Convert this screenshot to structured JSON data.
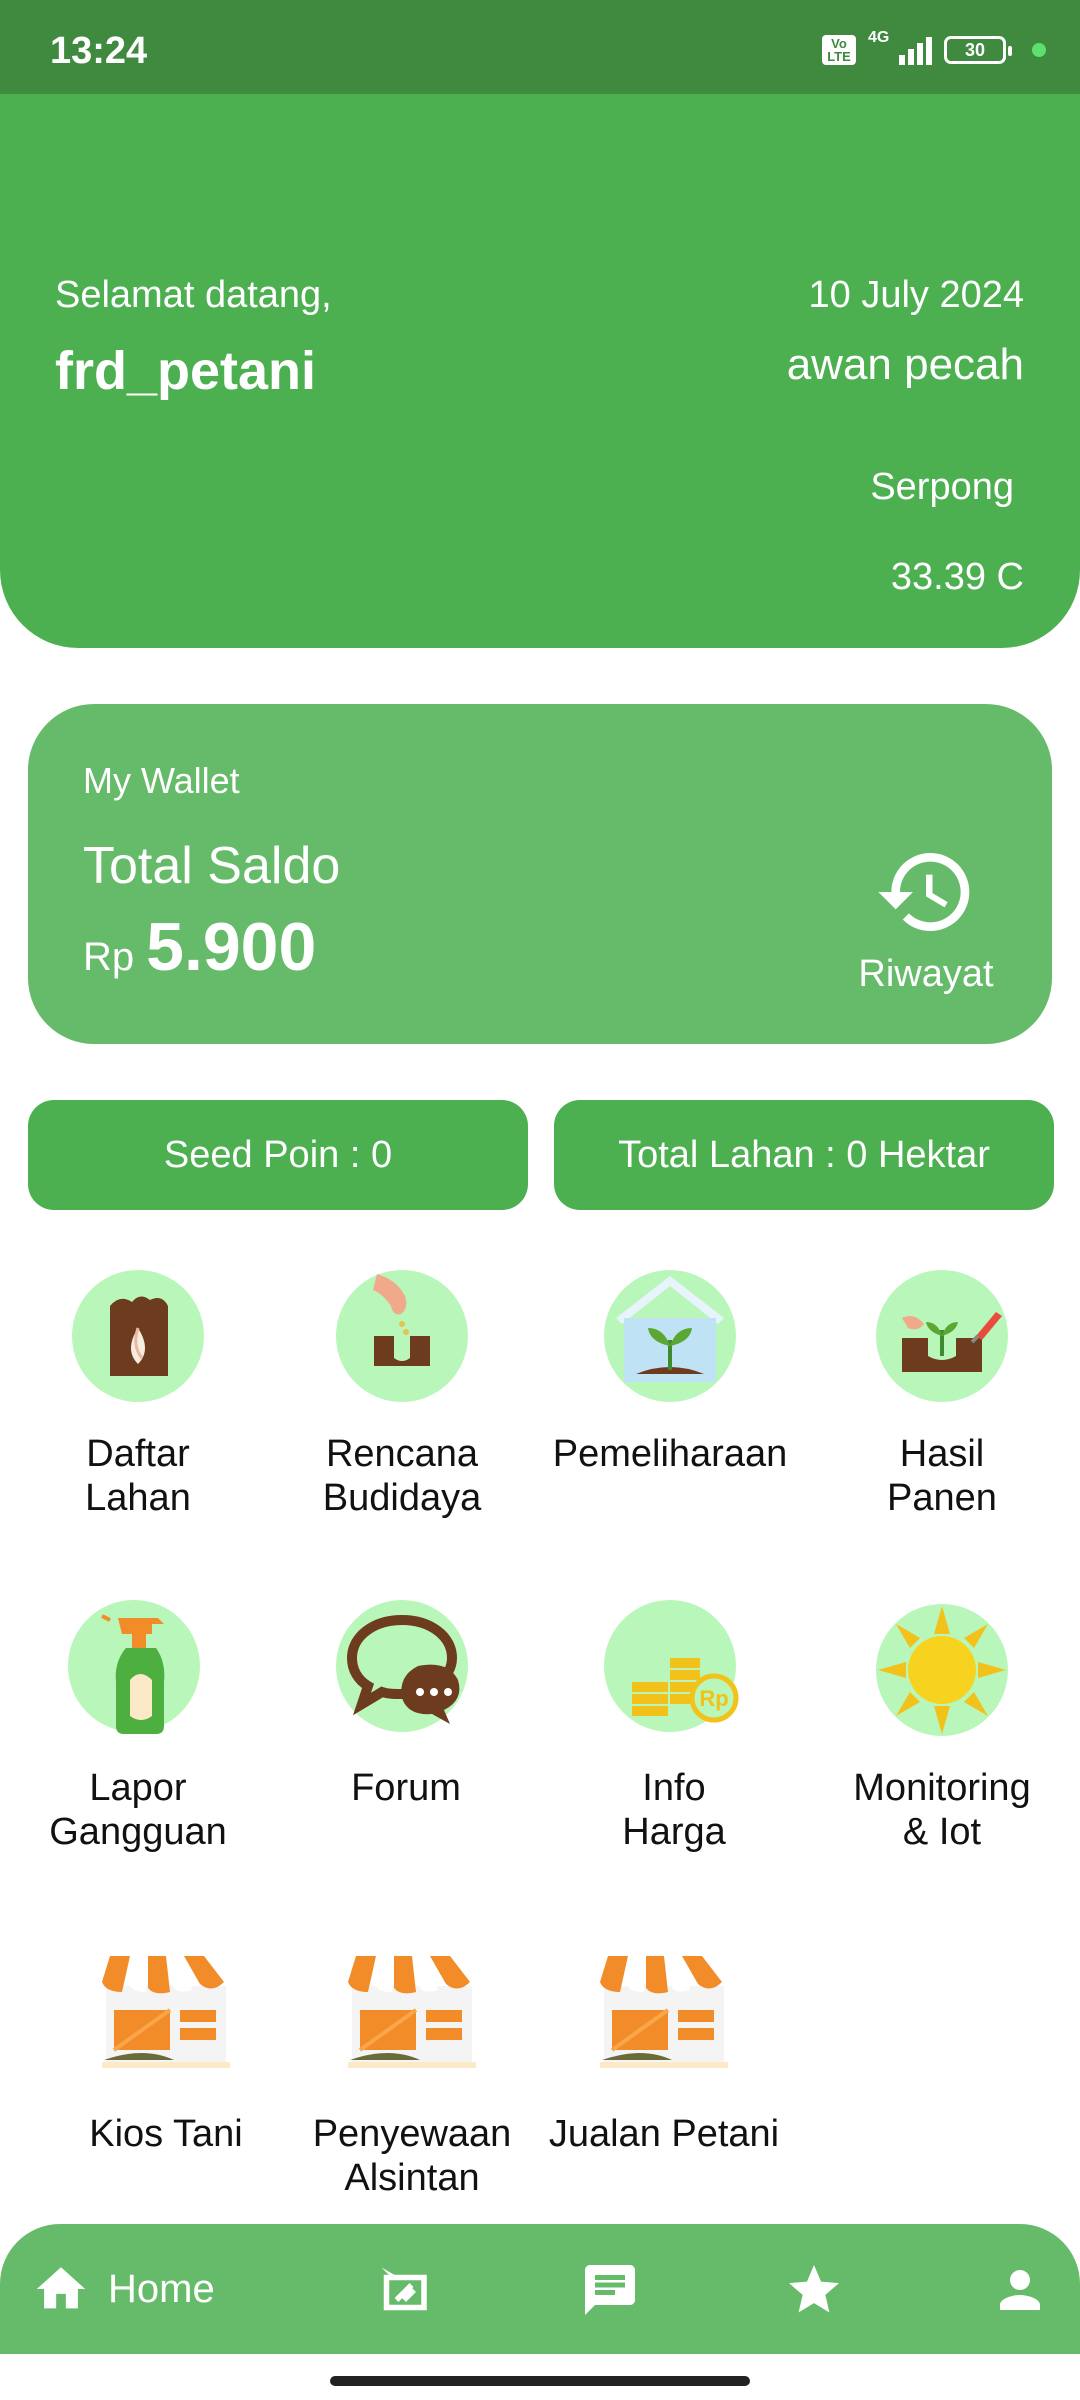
{
  "status_bar": {
    "time": "13:24",
    "volte": "Vo LTE",
    "network": "4G",
    "battery": "30"
  },
  "header": {
    "greeting": "Selamat datang,",
    "username": "frd_petani",
    "date": "10 July 2024",
    "weather": "awan pecah",
    "city": "Serpong",
    "temperature": "33.39 C"
  },
  "wallet": {
    "title": "My Wallet",
    "saldo_label": "Total Saldo",
    "currency": "Rp",
    "amount": "5.900",
    "history_label": "Riwayat",
    "history_icon": "history-icon"
  },
  "stats": {
    "seed_poin": "Seed Poin :  0",
    "total_lahan": "Total Lahan : 0 Hektar"
  },
  "menu": [
    {
      "label": "Daftar\nLahan",
      "icon": "seed-bag-icon"
    },
    {
      "label": "Rencana\nBudidaya",
      "icon": "planting-hand-icon"
    },
    {
      "label": "Pemeliharaan",
      "icon": "greenhouse-icon"
    },
    {
      "label": "Hasil\nPanen",
      "icon": "harvest-icon"
    },
    {
      "label": "Lapor\nGangguan",
      "icon": "spray-bottle-icon"
    },
    {
      "label": "Forum",
      "icon": "chat-bubbles-icon"
    },
    {
      "label": "Info\nHarga",
      "icon": "coins-price-icon"
    },
    {
      "label": "Monitoring\n& Iot",
      "icon": "sun-icon"
    },
    {
      "label": "Kios Tani",
      "icon": "store-icon"
    },
    {
      "label": "Penyewaan\nAlsintan",
      "icon": "store-icon"
    },
    {
      "label": "Jualan Petani",
      "icon": "store-icon"
    }
  ],
  "bottom_nav": {
    "home_label": "Home",
    "items": [
      "home-icon",
      "sign-icon",
      "message-icon",
      "star-icon",
      "person-icon"
    ]
  },
  "colors": {
    "primary": "#4caf50",
    "primary_light": "#66bb6a",
    "status_bar": "#3f8a3f",
    "icon_circle": "#b9f6b9"
  }
}
